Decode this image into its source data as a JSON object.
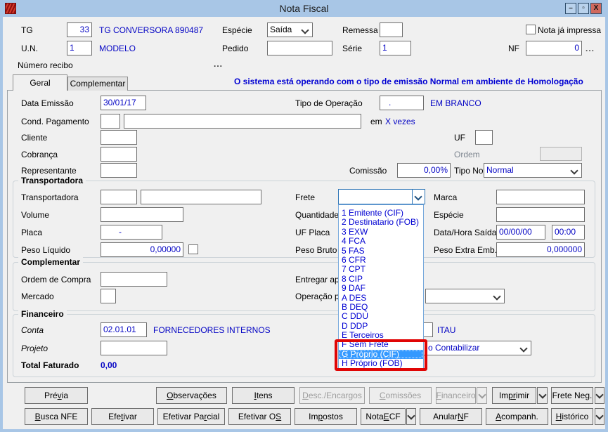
{
  "window": {
    "title": "Nota Fiscal",
    "controls": {
      "minimize": "–",
      "maximize": "▫",
      "close": "X"
    }
  },
  "header": {
    "tg": {
      "label": "TG",
      "value": "33",
      "desc": "TG CONVERSORA 890487"
    },
    "un": {
      "label": "U.N.",
      "value": "1",
      "desc": "MODELO"
    },
    "especie": {
      "label": "Espécie",
      "value": "Saída"
    },
    "pedido": {
      "label": "Pedido",
      "value": ""
    },
    "remessa": {
      "label": "Remessa",
      "value": ""
    },
    "serie": {
      "label": "Série",
      "value": "1"
    },
    "nota_ja_impressa": {
      "label": "Nota já impressa",
      "checked": false
    },
    "nf": {
      "label": "NF",
      "value": "0",
      "more": "..."
    },
    "numero_recibo": {
      "label": "Número recibo",
      "more": "..."
    }
  },
  "tabs": {
    "geral": "Geral",
    "complementar": "Complementar"
  },
  "info_message": "O sistema está operando com o tipo de emissão Normal em ambiente de Homologação",
  "geral": {
    "data_emissao": {
      "label": "Data Emissão",
      "value": "30/01/17"
    },
    "tipo_operacao": {
      "label": "Tipo de Operação",
      "value": ".",
      "desc": "EM BRANCO"
    },
    "cond_pagamento": {
      "label": "Cond. Pagamento",
      "code": "",
      "desc": "",
      "em": "em",
      "vezes": "X vezes"
    },
    "cliente": {
      "label": "Cliente",
      "value": ""
    },
    "uf": {
      "label": "UF",
      "value": ""
    },
    "cobranca": {
      "label": "Cobrança",
      "value": ""
    },
    "ordem": {
      "label": "Ordem",
      "value": ""
    },
    "representante": {
      "label": "Representante",
      "value": ""
    },
    "comissao": {
      "label": "Comissão",
      "value": "0,00%"
    },
    "tipo_nota": {
      "label": "Tipo Nota",
      "value": "Normal"
    }
  },
  "transportadora": {
    "title": "Transportadora",
    "transportadora": {
      "label": "Transportadora",
      "code": "",
      "desc": ""
    },
    "frete": {
      "label": "Frete",
      "value": ""
    },
    "marca": {
      "label": "Marca",
      "value": ""
    },
    "volume": {
      "label": "Volume",
      "value": ""
    },
    "quantidade": {
      "label": "Quantidade"
    },
    "especie": {
      "label": "Espécie",
      "value": ""
    },
    "placa": {
      "label": "Placa",
      "value": "-"
    },
    "uf_placa": {
      "label": "UF Placa"
    },
    "data_hora_saida": {
      "label": "Data/Hora Saída",
      "date": "00/00/00",
      "time": "00:00"
    },
    "peso_liquido": {
      "label": "Peso Líquido",
      "value": "0,00000"
    },
    "peso_bruto": {
      "label": "Peso Bruto"
    },
    "peso_extra": {
      "label": "Peso Extra Emb.",
      "value": "0,000000"
    }
  },
  "frete_dropdown": {
    "items": [
      "1 Emitente (CIF)",
      "2 Destinatario (FOB)",
      "3 EXW",
      "4 FCA",
      "5 FAS",
      "6 CFR",
      "7 CPT",
      "8 CIP",
      "9 DAF",
      "A DES",
      "B DEQ",
      "C DDU",
      "D DDP",
      "E Terceiros",
      "F Sem Frete",
      "G Próprio (CIF)",
      "H Próprio (FOB)"
    ],
    "highlighted": "G Próprio (CIF)",
    "highlight_color": "#3399ff",
    "annotation_color": "#e00505"
  },
  "complementar": {
    "title": "Complementar",
    "ordem_compra": {
      "label": "Ordem de Compra",
      "value": ""
    },
    "mercado": {
      "label": "Mercado",
      "value": ""
    },
    "entregar_apos": {
      "label": "Entregar após f"
    },
    "operacao_pres": {
      "label": "Operação prese",
      "value": ""
    }
  },
  "financeiro": {
    "title": "Financeiro",
    "conta": {
      "label": "Conta",
      "value": "02.01.01",
      "desc": "FORNECEDORES INTERNOS"
    },
    "banco": {
      "value": "",
      "desc": "ITAU"
    },
    "contabilizar": {
      "value_visible": "o Contabilizar"
    },
    "projeto": {
      "label": "Projeto",
      "value": ""
    },
    "total_faturado": {
      "label": "Total Faturado",
      "value": "0,00"
    }
  },
  "buttons": {
    "row1": [
      {
        "label": "Pré[v]ia",
        "enabled": true
      },
      {
        "label": "[O]bservações",
        "enabled": true
      },
      {
        "label": "[I]tens",
        "enabled": true
      },
      {
        "label": "[D]esc./Encargos",
        "enabled": false
      },
      {
        "label": "[C]omissões",
        "enabled": false
      },
      {
        "label": "[F]inanceiro",
        "enabled": false
      },
      {
        "label": "Im[pr]imir",
        "enabled": true
      },
      {
        "label": "Frete Ne[g].",
        "enabled": true
      }
    ],
    "row2": [
      {
        "label": "[B]usca NFE",
        "enabled": true
      },
      {
        "label": "Efe[t]ivar",
        "enabled": true
      },
      {
        "label": "Efetivar Pa[r]cial",
        "enabled": true
      },
      {
        "label": "Efetivar O[S]",
        "enabled": true
      },
      {
        "label": "Im[p]ostos",
        "enabled": true
      },
      {
        "label": "Nota [E]CF",
        "enabled": true
      },
      {
        "label": "Anular [N]F",
        "enabled": true
      },
      {
        "label": "[A]companh.",
        "enabled": true
      },
      {
        "label": "[H]istórico",
        "enabled": true
      }
    ]
  }
}
